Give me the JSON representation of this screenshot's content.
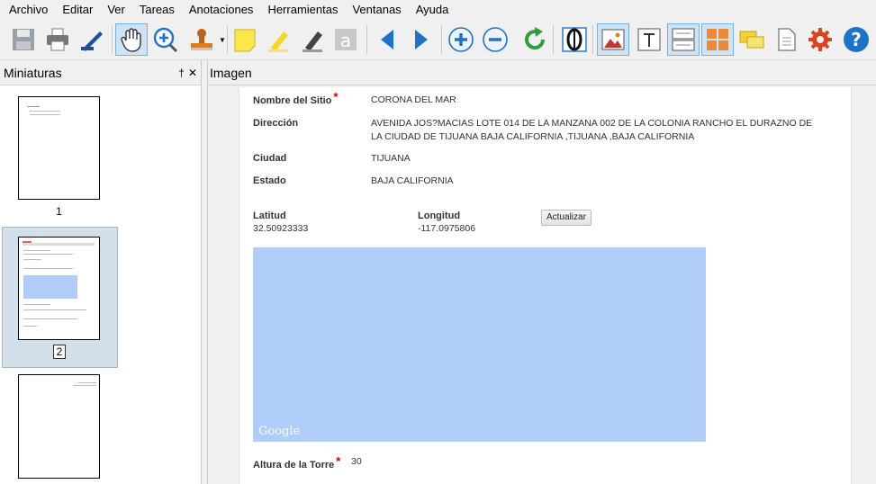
{
  "menu": [
    "Archivo",
    "Editar",
    "Ver",
    "Tareas",
    "Anotaciones",
    "Herramientas",
    "Ventanas",
    "Ayuda"
  ],
  "panels": {
    "thumbnails_title": "Miniaturas",
    "image_title": "Imagen",
    "pin_glyph": "†",
    "close_glyph": "✕"
  },
  "thumbnails": [
    {
      "page": "1",
      "selected": false
    },
    {
      "page": "2",
      "selected": true
    },
    {
      "page": "",
      "selected": false
    }
  ],
  "form": {
    "site_name_label": "Nombre del Sitio",
    "site_name_value": "CORONA DEL MAR",
    "address_label": "Dirección",
    "address_line1": "AVENIDA JOS?MACIAS LOTE 014 DE LA MANZANA 002 DE LA COLONIA RANCHO EL DURAZNO DE",
    "address_line2": "LA CIUDAD DE TIJUANA BAJA CALIFORNIA ,TIJUANA ,BAJA CALIFORNIA",
    "city_label": "Ciudad",
    "city_value": "TIJUANA",
    "state_label": "Estado",
    "state_value": "BAJA CALIFORNIA",
    "lat_label": "Latitud",
    "lat_value": "32.50923333",
    "lon_label": "Longitud",
    "lon_value": "-117.0975806",
    "update_button": "Actualizar",
    "map_logo": "Google",
    "tower_label": "Altura de la Torre",
    "tower_value": "30",
    "required_mark": "*"
  },
  "colors": {
    "map_fill": "#b0cdfa",
    "selected_thumb": "#d3dfe9",
    "required": "#cc0000",
    "accent_blue": "#1e72c8"
  }
}
